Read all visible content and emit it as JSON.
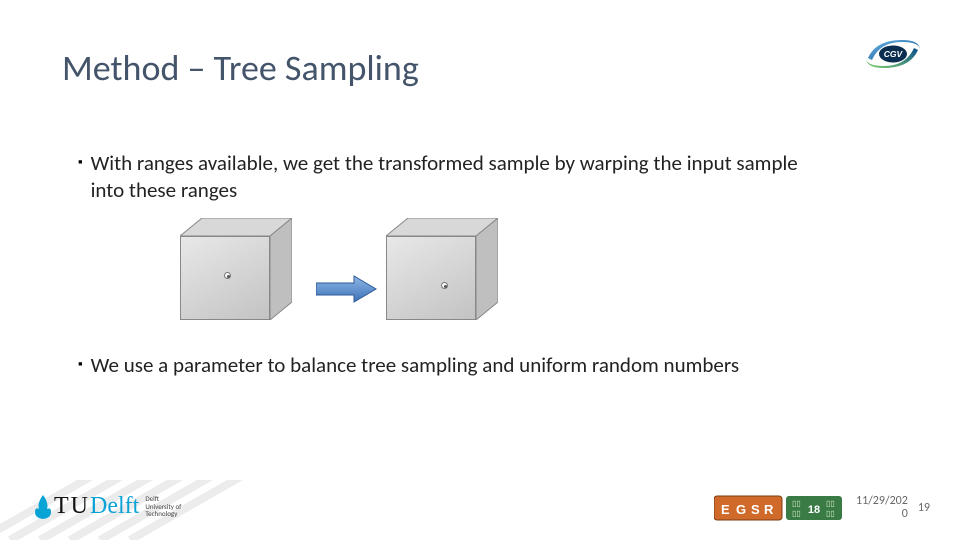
{
  "title": "Method – Tree Sampling",
  "bullets": {
    "b1": "With ranges available, we get the transformed sample by warping the input sample into these ranges",
    "b2": "We use a parameter to balance tree sampling and uniform random numbers"
  },
  "footer": {
    "uni_prefix": "T",
    "uni_name": "Delft",
    "uni_sub1": "Delft",
    "uni_sub2": "University of",
    "uni_sub3": "Technology",
    "conf_label1": "EGSR",
    "conf_label2": "2018",
    "date_line1": "11/29/202",
    "date_line2": "0",
    "page": "19"
  },
  "logo": {
    "cgv": "CGV"
  }
}
